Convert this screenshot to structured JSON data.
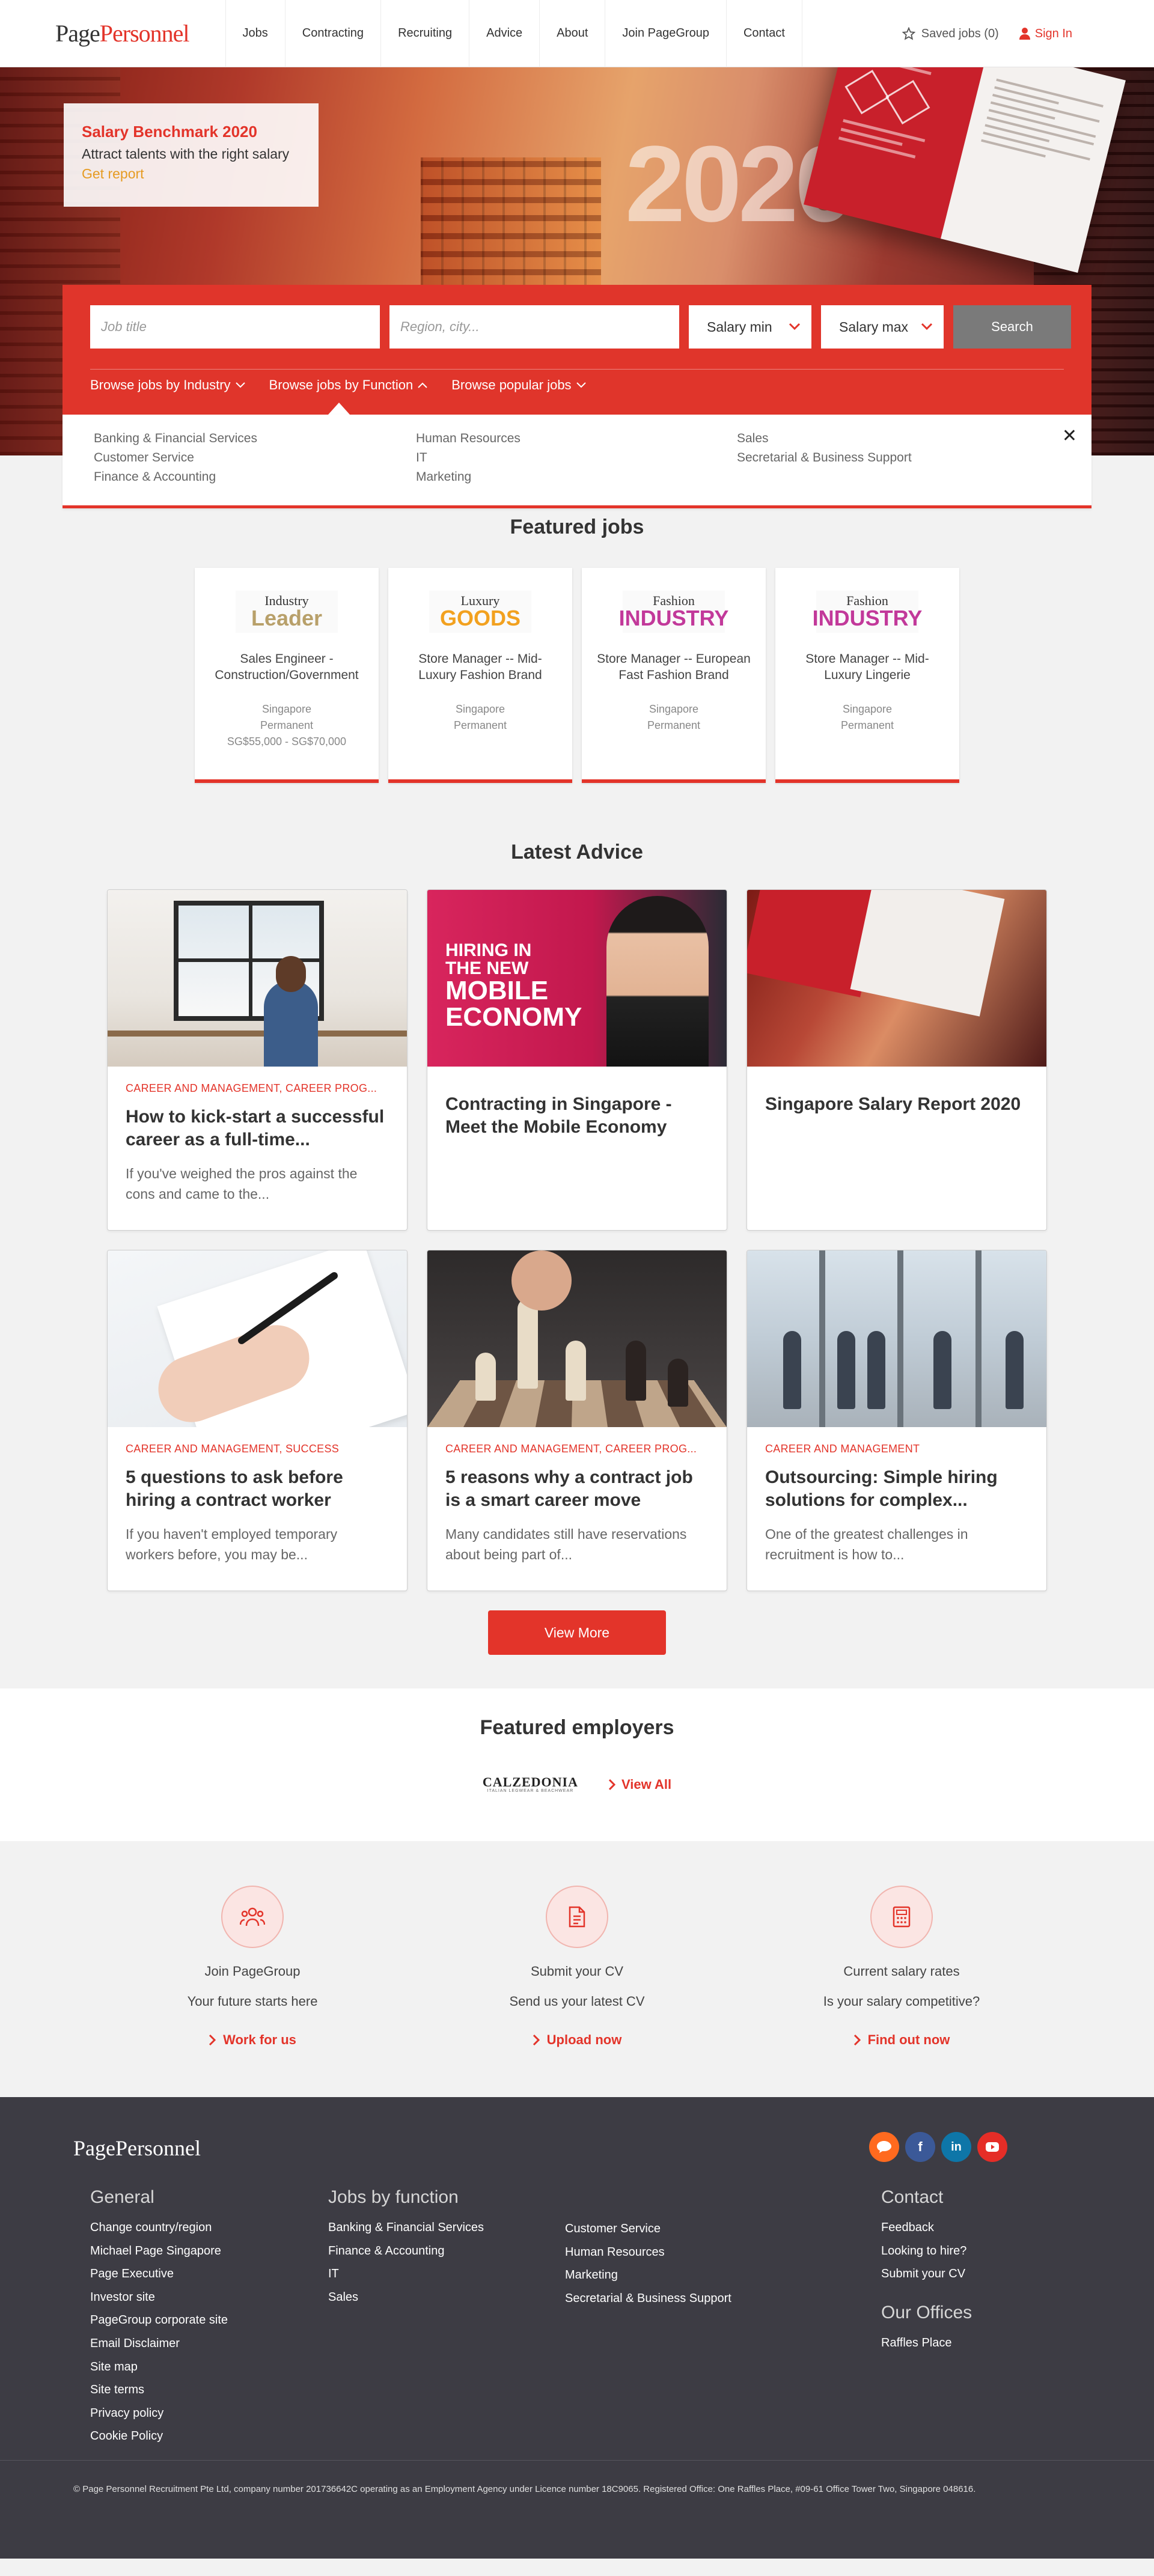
{
  "header": {
    "logo_part1": "Page",
    "logo_part2": "Personnel",
    "nav": [
      "Jobs",
      "Contracting",
      "Recruiting",
      "Advice",
      "About",
      "Join PageGroup",
      "Contact"
    ],
    "saved_jobs": "Saved jobs (0)",
    "sign_in": "Sign In"
  },
  "hero": {
    "year": "2020",
    "promo": {
      "title": "Salary Benchmark 2020",
      "subtitle": "Attract talents with the right salary",
      "link": "Get report"
    }
  },
  "search": {
    "job_placeholder": "Job title",
    "region_placeholder": "Region, city...",
    "salary_min": "Salary min",
    "salary_max": "Salary max",
    "search_label": "Search",
    "browse": [
      "Browse jobs by Industry",
      "Browse jobs by Function",
      "Browse popular jobs"
    ]
  },
  "functions": {
    "col1": [
      "Banking & Financial Services",
      "Customer Service",
      "Finance & Accounting"
    ],
    "col2": [
      "Human Resources",
      "IT",
      "Marketing"
    ],
    "col3": [
      "Sales",
      "Secretarial & Business Support"
    ]
  },
  "featured_jobs": {
    "title": "Featured jobs",
    "jobs": [
      {
        "logo_top": "Industry",
        "logo_bottom": "Leader",
        "color": "#b8a06a",
        "title": "Sales Engineer - Construction/Government",
        "location": "Singapore",
        "type": "Permanent",
        "salary": "SG$55,000 - SG$70,000"
      },
      {
        "logo_top": "Luxury",
        "logo_bottom": "GOODS",
        "color": "#f2a11f",
        "title": "Store Manager -- Mid-Luxury Fashion Brand",
        "location": "Singapore",
        "type": "Permanent",
        "salary": ""
      },
      {
        "logo_top": "Fashion",
        "logo_bottom": "INDUSTRY",
        "color": "#c2399a",
        "title": "Store Manager -- European Fast Fashion Brand",
        "location": "Singapore",
        "type": "Permanent",
        "salary": ""
      },
      {
        "logo_top": "Fashion",
        "logo_bottom": "INDUSTRY",
        "color": "#c2399a",
        "title": "Store Manager -- Mid-Luxury Lingerie",
        "location": "Singapore",
        "type": "Permanent",
        "salary": ""
      }
    ]
  },
  "latest_advice": {
    "title": "Latest Advice",
    "mobile_img_line1": "HIRING IN",
    "mobile_img_line2": "THE NEW",
    "mobile_img_line3": "MOBILE",
    "mobile_img_line4": "ECONOMY",
    "articles": [
      {
        "tag": "Career and Management, Career Prog...",
        "title": "How to kick-start a successful career as a full-time...",
        "excerpt": "If you've weighed the pros against the cons and came to the..."
      },
      {
        "tag": "",
        "title": "Contracting in Singapore - Meet the Mobile Economy",
        "excerpt": ""
      },
      {
        "tag": "",
        "title": "Singapore Salary Report 2020",
        "excerpt": ""
      },
      {
        "tag": "Career and Management, Success",
        "title": "5 questions to ask before hiring a contract worker",
        "excerpt": "If you haven't employed temporary workers before, you may be..."
      },
      {
        "tag": "Career and Management, Career Prog...",
        "title": "5 reasons why a contract job is a smart career move",
        "excerpt": "Many candidates still have reservations about being part of..."
      },
      {
        "tag": "Career and Management",
        "title": "Outsourcing: Simple hiring solutions for complex...",
        "excerpt": "One of the greatest challenges in recruitment is how to..."
      }
    ],
    "view_more": "View More"
  },
  "employers": {
    "title": "Featured employers",
    "calzedonia": "CALZEDONIA",
    "calzedonia_sub": "ITALIAN LEGWEAR & BEACHWEAR",
    "view_all": "View All"
  },
  "cta": [
    {
      "icon": "people-icon",
      "title": "Join PageGroup",
      "subtitle": "Your future starts here",
      "link": "Work for us"
    },
    {
      "icon": "document-icon",
      "title": "Submit your CV",
      "subtitle": "Send us your latest CV",
      "link": "Upload now"
    },
    {
      "icon": "calculator-icon",
      "title": "Current salary rates",
      "subtitle": "Is your salary competitive?",
      "link": "Find out now"
    }
  ],
  "footer": {
    "logo": "PagePersonnel",
    "general_title": "General",
    "general": [
      "Change country/region",
      "Michael Page Singapore",
      "Page Executive",
      "Investor site",
      "PageGroup corporate site",
      "Email Disclaimer",
      "Site map",
      "Site terms",
      "Privacy policy",
      "Cookie Policy"
    ],
    "jobs_title": "Jobs by function",
    "jobs_col1": [
      "Banking & Financial Services",
      "Finance & Accounting",
      "IT",
      "Sales"
    ],
    "jobs_col2": [
      "Customer Service",
      "Human Resources",
      "Marketing",
      "Secretarial & Business Support"
    ],
    "contact_title": "Contact",
    "contact": [
      "Feedback",
      "Looking to hire?",
      "Submit your CV"
    ],
    "offices_title": "Our Offices",
    "offices": [
      "Raffles Place"
    ],
    "social_colors": {
      "chat": "#ff6a1f",
      "facebook": "#3b5998",
      "linkedin": "#0e76a8",
      "youtube": "#e52d27"
    },
    "legal": "© Page Personnel Recruitment Pte Ltd, company number 201736642C operating as an Employment Agency under Licence number 18C9065. Registered Office: One Raffles Place, #09-61 Office Tower Two, Singapore 048616."
  }
}
